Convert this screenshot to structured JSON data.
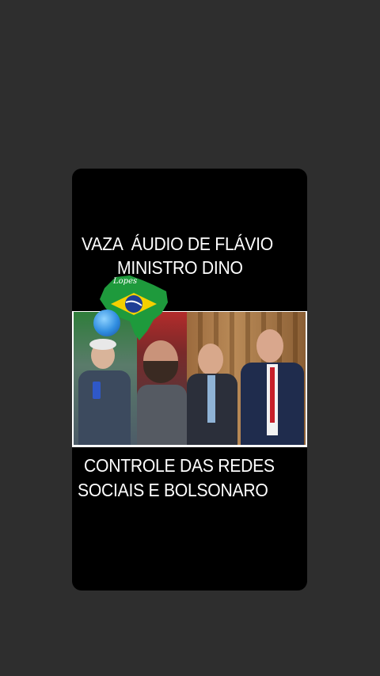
{
  "post": {
    "headline_line1": "VAZA  ÁUDIO DE FLÁVIO",
    "headline_line2": "MINISTRO DINO",
    "bottom_line1": "CONTROLE DAS REDES",
    "bottom_line2": "SOCIAIS E BOLSONARO",
    "watermark": "Lopes"
  },
  "colors": {
    "page_background": "#2e2e2e",
    "card_background": "#000000",
    "text": "#ffffff",
    "flag_green": "#1e9a3c",
    "flag_yellow": "#f5d000",
    "flag_blue": "#1f3f95"
  }
}
